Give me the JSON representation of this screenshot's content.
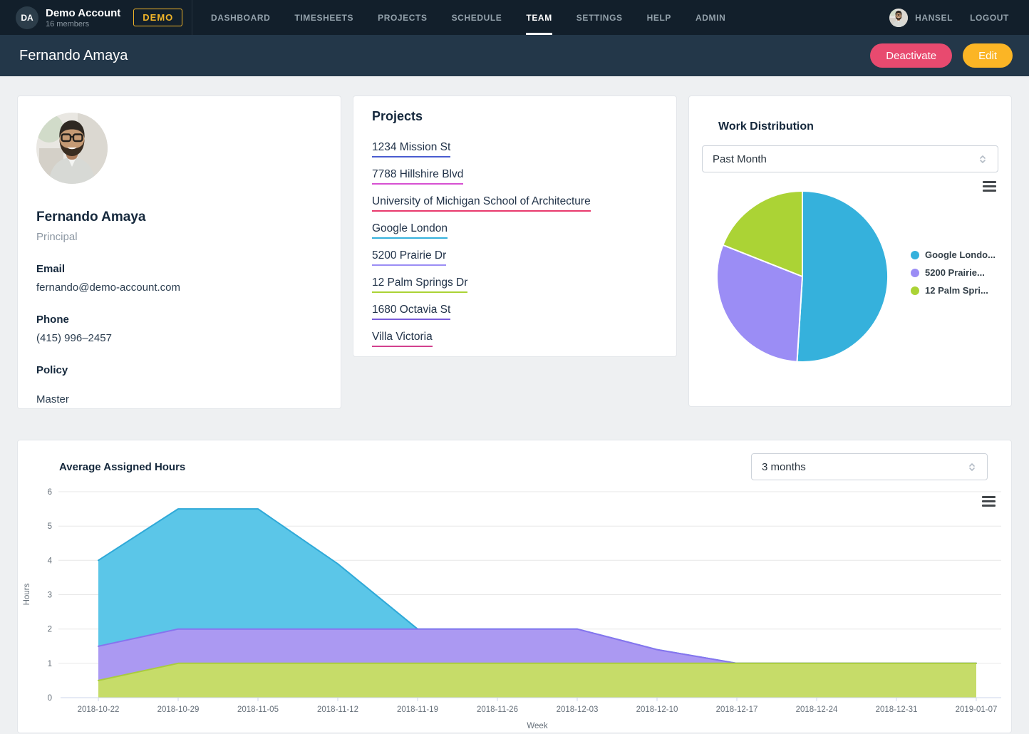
{
  "topnav": {
    "account": {
      "initials": "DA",
      "name": "Demo Account",
      "members": "16 members",
      "badge": "DEMO"
    },
    "items": [
      {
        "label": "DASHBOARD",
        "active": false
      },
      {
        "label": "TIMESHEETS",
        "active": false
      },
      {
        "label": "PROJECTS",
        "active": false
      },
      {
        "label": "SCHEDULE",
        "active": false
      },
      {
        "label": "TEAM",
        "active": true
      },
      {
        "label": "SETTINGS",
        "active": false
      },
      {
        "label": "HELP",
        "active": false
      },
      {
        "label": "ADMIN",
        "active": false
      }
    ],
    "user": {
      "name": "HANSEL",
      "logout": "LOGOUT"
    }
  },
  "page_header": {
    "title": "Fernando Amaya",
    "deactivate": "Deactivate",
    "edit": "Edit"
  },
  "profile": {
    "name": "Fernando Amaya",
    "role": "Principal",
    "email_label": "Email",
    "email": "fernando@demo-account.com",
    "phone_label": "Phone",
    "phone": "(415) 996–2457",
    "policy_label": "Policy",
    "policy": "Master"
  },
  "projects": {
    "title": "Projects",
    "items": [
      {
        "label": "1234 Mission St",
        "underline_color": "#4a5cd0"
      },
      {
        "label": "7788 Hillshire Blvd",
        "underline_color": "#d750d2"
      },
      {
        "label": "University of Michigan School of Architecture",
        "underline_color": "#e83a6d"
      },
      {
        "label": "Google London",
        "underline_color": "#35b1dc"
      },
      {
        "label": "5200 Prairie Dr",
        "underline_color": "#9b8df5"
      },
      {
        "label": "12 Palm Springs Dr",
        "underline_color": "#abd335"
      },
      {
        "label": "1680 Octavia St",
        "underline_color": "#7a5dd9"
      },
      {
        "label": "Villa Victoria",
        "underline_color": "#d2418e"
      }
    ]
  },
  "work_distribution": {
    "title": "Work Distribution",
    "period": "Past Month"
  },
  "average_assigned_hours": {
    "title": "Average Assigned Hours",
    "period": "3 months"
  },
  "chart_data": [
    {
      "type": "pie",
      "title": "Work Distribution",
      "period": "Past Month",
      "legend_position": "right",
      "slices": [
        {
          "label": "Google Londo...",
          "full_label": "Google London",
          "value_pct": 51,
          "color": "#35b1dc"
        },
        {
          "label": "5200 Prairie...",
          "full_label": "5200 Prairie Dr",
          "value_pct": 30,
          "color": "#9b8df5"
        },
        {
          "label": "12 Palm Spri...",
          "full_label": "12 Palm Springs Dr",
          "value_pct": 19,
          "color": "#abd335"
        }
      ]
    },
    {
      "type": "area",
      "stacked": true,
      "title": "Average Assigned Hours",
      "xlabel": "Week",
      "ylabel": "Hours",
      "ylim": [
        0,
        6
      ],
      "yticks": [
        0,
        1,
        2,
        3,
        4,
        5,
        6
      ],
      "grid": true,
      "categories": [
        "2018-10-22",
        "2018-10-29",
        "2018-11-05",
        "2018-11-12",
        "2018-11-19",
        "2018-11-26",
        "2018-12-03",
        "2018-12-10",
        "2018-12-17",
        "2018-12-24",
        "2018-12-31",
        "2019-01-07"
      ],
      "series": [
        {
          "name": "Google London",
          "color": "#2fa9d8",
          "fill": "#5bc6e8",
          "values": [
            2.5,
            3.5,
            3.5,
            1.9,
            0,
            0,
            0,
            0,
            0,
            0,
            0,
            0
          ]
        },
        {
          "name": "5200 Prairie Dr",
          "color": "#8674ee",
          "fill": "#ab99f2",
          "values": [
            1,
            1,
            1,
            1,
            1,
            1,
            1,
            0.4,
            0,
            0,
            0,
            0
          ]
        },
        {
          "name": "12 Palm Springs Dr",
          "color": "#a9cc3e",
          "fill": "#c6dc69",
          "values": [
            0.5,
            1,
            1,
            1,
            1,
            1,
            1,
            1,
            1,
            1,
            1,
            1
          ]
        }
      ]
    }
  ]
}
